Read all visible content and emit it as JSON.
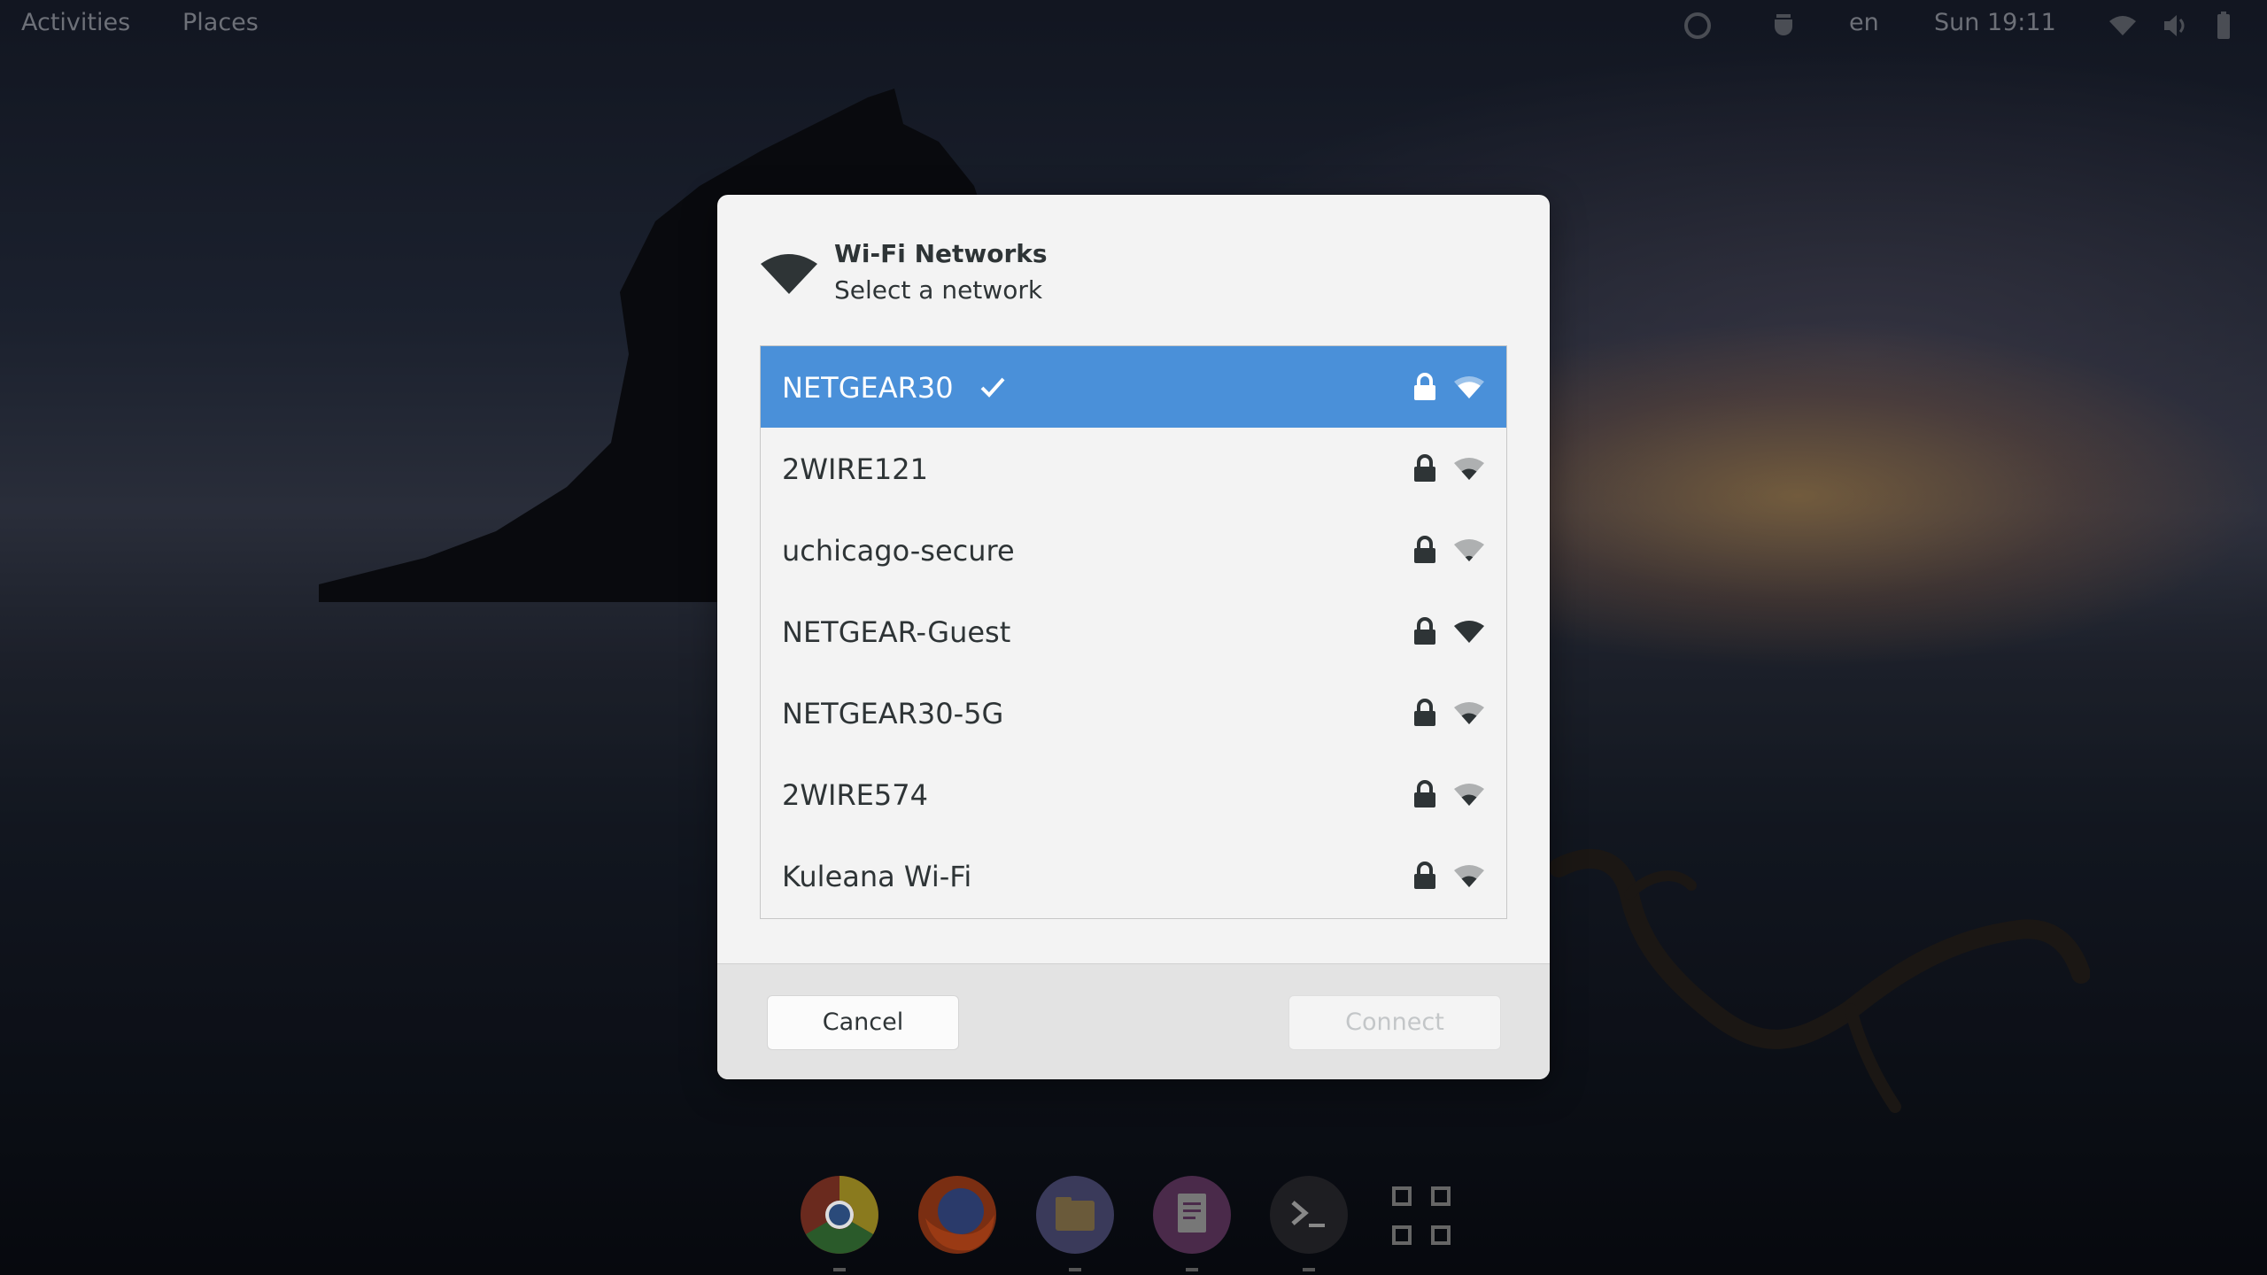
{
  "topbar": {
    "activities": "Activities",
    "places": "Places",
    "language": "en",
    "clock": "Sun 19:11",
    "icons": [
      "sync-icon",
      "tea-cup-icon",
      "wifi-icon",
      "volume-icon",
      "battery-icon"
    ]
  },
  "dialog": {
    "title": "Wi-Fi Networks",
    "subtitle": "Select a network",
    "header_icon": "wifi-icon",
    "networks": [
      {
        "name": "NETGEAR30",
        "selected": true,
        "connected": true,
        "secured": true,
        "signal": "good"
      },
      {
        "name": "2WIRE121",
        "selected": false,
        "connected": false,
        "secured": true,
        "signal": "ok"
      },
      {
        "name": "uchicago-secure",
        "selected": false,
        "connected": false,
        "secured": true,
        "signal": "weak"
      },
      {
        "name": "NETGEAR-Guest",
        "selected": false,
        "connected": false,
        "secured": true,
        "signal": "excellent"
      },
      {
        "name": "NETGEAR30-5G",
        "selected": false,
        "connected": false,
        "secured": true,
        "signal": "ok"
      },
      {
        "name": "2WIRE574",
        "selected": false,
        "connected": false,
        "secured": true,
        "signal": "ok"
      },
      {
        "name": "Kuleana Wi-Fi",
        "selected": false,
        "connected": false,
        "secured": true,
        "signal": "ok"
      }
    ],
    "cancel_label": "Cancel",
    "connect_label": "Connect",
    "connect_enabled": false
  },
  "dock": {
    "apps": [
      "chrome-icon",
      "firefox-icon",
      "files-icon",
      "text-editor-icon",
      "terminal-icon",
      "show-applications-icon"
    ]
  },
  "colors": {
    "selection": "#4a90d9",
    "dialog_bg": "#f3f3f3",
    "footer_bg": "#e3e3e3",
    "text": "#2e3436"
  }
}
